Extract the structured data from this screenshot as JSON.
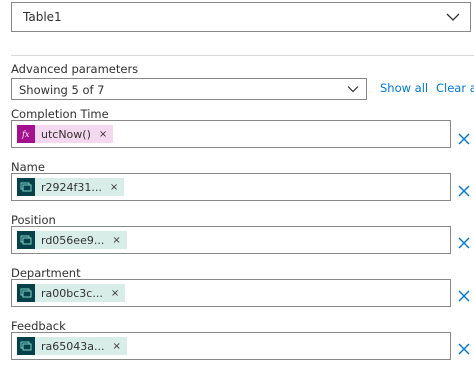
{
  "table_select": {
    "value": "Table1",
    "icon": "chevron-down-icon"
  },
  "advanced": {
    "label": "Advanced parameters",
    "select_value": "Showing 5 of 7",
    "show_all": "Show all",
    "clear_all": "Clear al"
  },
  "params": [
    {
      "label": "Completion Time",
      "token": "utcNow()",
      "token_type": "expression",
      "icon": "fx-icon"
    },
    {
      "label": "Name",
      "token": "r2924f31...",
      "token_type": "dynamic-content",
      "icon": "dataverse-table-icon"
    },
    {
      "label": "Position",
      "token": "rd056ee9...",
      "token_type": "dynamic-content",
      "icon": "dataverse-table-icon"
    },
    {
      "label": "Department",
      "token": "ra00bc3c...",
      "token_type": "dynamic-content",
      "icon": "dataverse-table-icon"
    },
    {
      "label": "Feedback",
      "token": "ra65043a...",
      "token_type": "dynamic-content",
      "icon": "dataverse-table-icon"
    }
  ],
  "token_remove": "×",
  "colors": {
    "link": "#0078d4",
    "expression_token_bg": "#f4d8ef",
    "expression_icon_bg": "#a4118f",
    "dynamic_token_bg": "#d9ede8",
    "dynamic_icon_bg": "#05414a",
    "remove_x": "#0078d4"
  }
}
